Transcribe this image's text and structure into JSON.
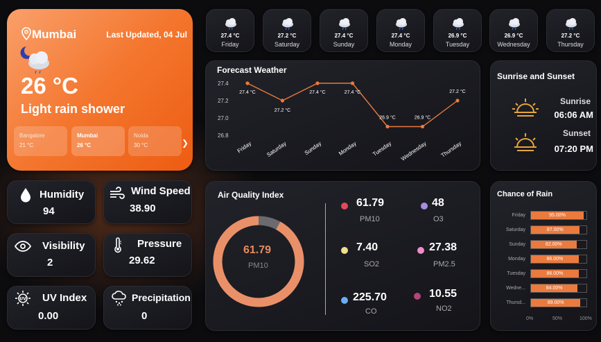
{
  "current": {
    "city": "Mumbai",
    "updated": "Last Updated, 04 Jul",
    "temp": "26 °C",
    "condition": "Light rain shower",
    "cities": [
      {
        "name": "Bangalore",
        "temp": "21 °C"
      },
      {
        "name": "Mumbai",
        "temp": "26 °C"
      },
      {
        "name": "Noida",
        "temp": "30 °C"
      }
    ]
  },
  "days": [
    {
      "name": "Friday",
      "temp": "27.4 °C"
    },
    {
      "name": "Saturday",
      "temp": "27.2 °C"
    },
    {
      "name": "Sunday",
      "temp": "27.4 °C"
    },
    {
      "name": "Monday",
      "temp": "27.4 °C"
    },
    {
      "name": "Tuesday",
      "temp": "26.9 °C"
    },
    {
      "name": "Wednesday",
      "temp": "26.9 °C"
    },
    {
      "name": "Thursday",
      "temp": "27.2 °C"
    }
  ],
  "forecast": {
    "title": "Forecast Weather",
    "accent": "#ea7a3e"
  },
  "chart_data": [
    {
      "type": "line",
      "title": "Forecast Weather",
      "categories": [
        "Friday",
        "Saturday",
        "Sunday",
        "Monday",
        "Tuesday",
        "Wednesday",
        "Thursday"
      ],
      "values": [
        27.4,
        27.2,
        27.4,
        27.4,
        26.9,
        26.9,
        27.2
      ],
      "data_labels": [
        "27.4 °C",
        "27.2 °C",
        "27.4 °C",
        "27.4 °C",
        "26.9 °C",
        "26.9 °C",
        "27.2 °C"
      ],
      "yticks": [
        "27.4",
        "27.2",
        "27.0",
        "26.8"
      ],
      "ylim": [
        26.8,
        27.4
      ]
    },
    {
      "type": "bar",
      "title": "Chance of Rain",
      "categories": [
        "Friday",
        "Saturday",
        "Sunday",
        "Monday",
        "Tuesday",
        "Wedne...",
        "Thursd..."
      ],
      "values": [
        95,
        87,
        82,
        86,
        86,
        84,
        89
      ],
      "data_labels": [
        "95.00%",
        "87.00%",
        "82.00%",
        "86.00%",
        "86.00%",
        "84.00%",
        "89.00%"
      ],
      "xticks": [
        "0%",
        "50%",
        "100%"
      ],
      "xlim": [
        0,
        100
      ]
    }
  ],
  "sun": {
    "title": "Sunrise and Sunset",
    "sunrise_label": "Sunrise",
    "sunrise": "06:06 AM",
    "sunset_label": "Sunset",
    "sunset": "07:20 PM"
  },
  "stats": {
    "humidity_label": "Humidity",
    "humidity": "94",
    "wind_label": "Wind Speed",
    "wind": "38.90",
    "visibility_label": "Visibility",
    "visibility": "2",
    "pressure_label": "Pressure",
    "pressure": "29.62",
    "uv_label": "UV Index",
    "uv": "0.00",
    "precip_label": "Precipitation",
    "precip": "0"
  },
  "aqi": {
    "title": "Air Quality Index",
    "center_value": "61.79",
    "center_label": "PM10",
    "gauge_fraction": 0.92,
    "items": [
      {
        "value": "61.79",
        "name": "PM10",
        "color": "#e04b5a"
      },
      {
        "value": "48",
        "name": "O3",
        "color": "#a58ee0"
      },
      {
        "value": "7.40",
        "name": "SO2",
        "color": "#f0e08c"
      },
      {
        "value": "27.38",
        "name": "PM2.5",
        "color": "#f08cc8"
      },
      {
        "value": "225.70",
        "name": "CO",
        "color": "#6aaef0"
      },
      {
        "value": "10.55",
        "name": "NO2",
        "color": "#b4447c"
      }
    ]
  },
  "rain": {
    "title": "Chance of Rain"
  }
}
